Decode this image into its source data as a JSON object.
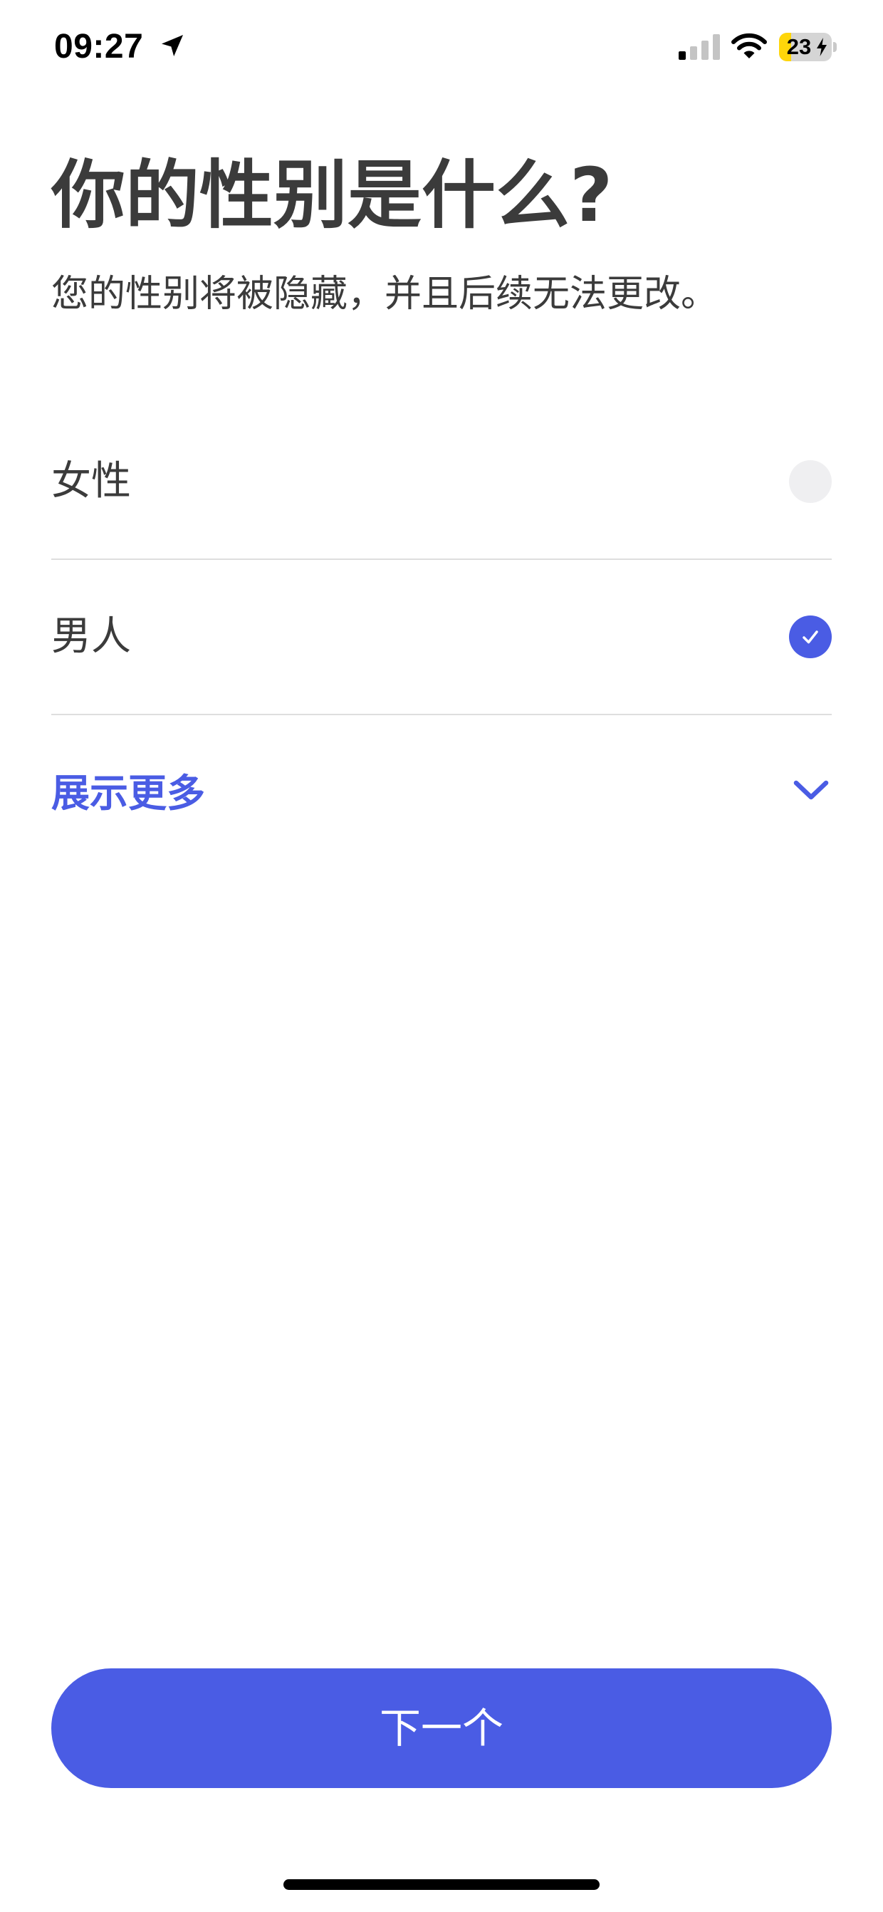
{
  "status_bar": {
    "time": "09:27",
    "battery_level": "23",
    "battery_fraction": 0.23,
    "battery_color": "#ffd60a",
    "icons": [
      "location-arrow-icon",
      "cellular-signal-icon",
      "wifi-icon",
      "battery-charging-icon"
    ]
  },
  "header": {
    "title": "你的性别是什么?",
    "subtitle": "您的性别将被隐藏，并且后续无法更改。"
  },
  "options": [
    {
      "label": "女性",
      "selected": false
    },
    {
      "label": "男人",
      "selected": true
    }
  ],
  "show_more": {
    "label": "展示更多",
    "icon": "chevron-down-icon"
  },
  "footer": {
    "next_label": "下一个"
  },
  "colors": {
    "accent": "#4a5ce4",
    "text": "#3b3b3b",
    "divider": "#dedede",
    "radio_unselected": "#efeff1"
  }
}
